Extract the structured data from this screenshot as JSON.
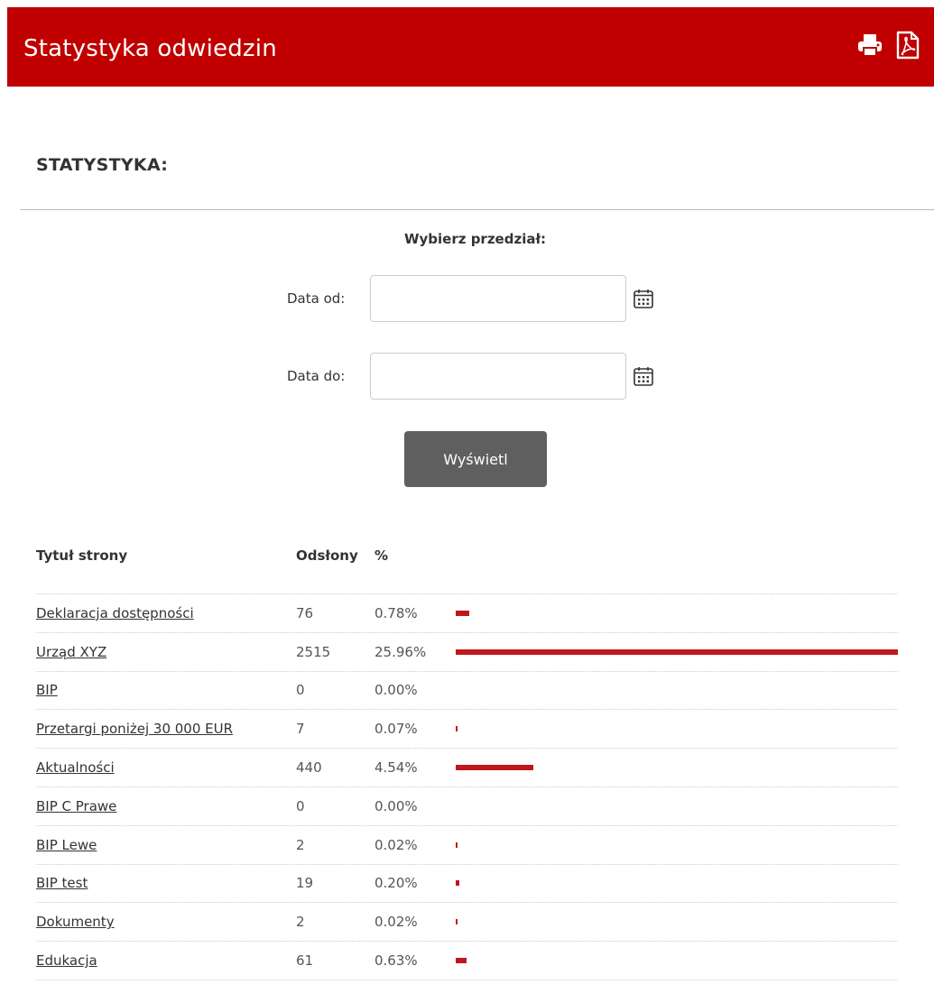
{
  "header": {
    "title": "Statystyka odwiedzin",
    "accent_color": "#c00000",
    "icons": [
      "print-icon",
      "pdf-icon"
    ]
  },
  "section": {
    "title": "STATYSTYKA:"
  },
  "filter": {
    "heading": "Wybierz przedział:",
    "date_from_label": "Data od:",
    "date_from_value": "",
    "date_to_label": "Data do:",
    "date_to_value": "",
    "calendar_icon": "calendar-icon",
    "submit_label": "Wyświetl"
  },
  "table": {
    "headers": {
      "title": "Tytuł strony",
      "views": "Odsłony",
      "percent": "%"
    },
    "bar_color": "#c0171d",
    "max_percent": 25.96,
    "rows": [
      {
        "title": "Deklaracja dostępności",
        "views": "76",
        "percent_label": "0.78%",
        "percent": 0.78
      },
      {
        "title": "Urząd XYZ",
        "views": "2515",
        "percent_label": "25.96%",
        "percent": 25.96
      },
      {
        "title": "BIP",
        "views": "0",
        "percent_label": "0.00%",
        "percent": 0.0
      },
      {
        "title": "Przetargi poniżej 30 000 EUR",
        "views": "7",
        "percent_label": "0.07%",
        "percent": 0.07
      },
      {
        "title": "Aktualności",
        "views": "440",
        "percent_label": "4.54%",
        "percent": 4.54
      },
      {
        "title": "BIP C Prawe",
        "views": "0",
        "percent_label": "0.00%",
        "percent": 0.0
      },
      {
        "title": "BIP Lewe",
        "views": "2",
        "percent_label": "0.02%",
        "percent": 0.02
      },
      {
        "title": "BIP test",
        "views": "19",
        "percent_label": "0.20%",
        "percent": 0.2
      },
      {
        "title": "Dokumenty",
        "views": "2",
        "percent_label": "0.02%",
        "percent": 0.02
      },
      {
        "title": "Edukacja",
        "views": "61",
        "percent_label": "0.63%",
        "percent": 0.63
      }
    ]
  }
}
